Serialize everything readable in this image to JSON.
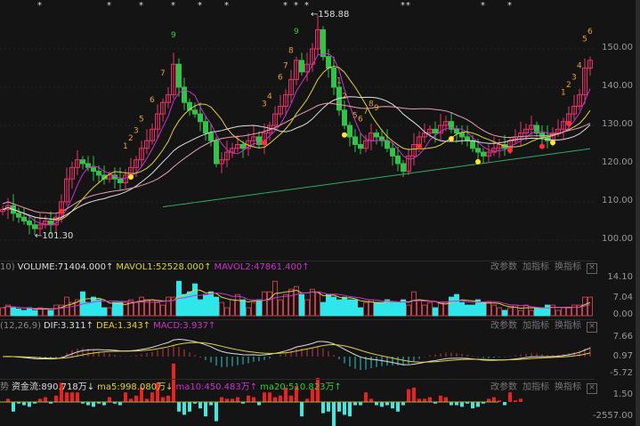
{
  "chart_data": {
    "type": "candlestick",
    "price_axis": {
      "ticks": [
        "150.00",
        "140.00",
        "130.00",
        "120.00",
        "110.00",
        "100.00"
      ],
      "range": [
        96,
        160
      ]
    },
    "closes": [
      108,
      109,
      107,
      106,
      105,
      104,
      103,
      104,
      105,
      104,
      106,
      110,
      116,
      119,
      121,
      120,
      119,
      118,
      117,
      116,
      117,
      116,
      115,
      117,
      119,
      121,
      124,
      126,
      129,
      133,
      136,
      138,
      146,
      140,
      136,
      134,
      133,
      131,
      128,
      126,
      120,
      121,
      123,
      124,
      125,
      124,
      126,
      127,
      125,
      128,
      130,
      133,
      135,
      138,
      142,
      147,
      144,
      146,
      150,
      155,
      148,
      145,
      140,
      134,
      130,
      127,
      125,
      124,
      126,
      128,
      127,
      126,
      124,
      122,
      120,
      118,
      122,
      125,
      127,
      128,
      129,
      128,
      130,
      131,
      129,
      128,
      127,
      126,
      124,
      123,
      122,
      123,
      124,
      125,
      124,
      126,
      127,
      128,
      129,
      130,
      128,
      127,
      126,
      128,
      129,
      131,
      133,
      135,
      138,
      145,
      147
    ],
    "volumes": [
      3,
      4,
      3,
      2.5,
      2,
      3,
      2,
      3,
      2.5,
      2,
      4,
      4,
      7,
      5,
      6,
      9,
      5,
      7,
      6,
      3,
      3,
      5,
      5,
      5,
      6,
      5,
      7,
      6,
      6,
      5,
      4,
      7,
      7,
      13,
      8,
      9,
      12,
      6,
      8,
      9,
      7,
      5,
      3,
      6,
      8,
      6,
      3,
      5,
      6,
      9,
      9,
      13,
      6,
      8,
      10,
      11,
      8,
      6,
      10,
      9,
      5,
      8,
      7,
      6,
      7,
      6,
      6,
      3,
      5,
      6,
      5,
      5,
      6,
      5,
      5,
      6,
      4,
      9,
      6,
      4,
      5,
      3,
      5,
      5,
      7,
      8,
      5,
      4,
      4,
      6,
      5,
      5,
      4,
      3,
      2,
      3,
      4,
      2,
      4,
      2,
      3,
      3,
      4,
      4,
      2,
      3,
      3,
      4,
      4,
      7,
      7
    ],
    "annotations": {
      "high": "←158.88",
      "low": "←101.30"
    },
    "count_labels": [
      {
        "i": 32,
        "t": "9",
        "c": "#3ad13a"
      },
      {
        "i": 26,
        "t": "5",
        "c": "#e6a23c"
      },
      {
        "i": 28,
        "t": "6",
        "c": "#e6a23c"
      },
      {
        "i": 30,
        "t": "7",
        "c": "#e6a23c"
      },
      {
        "i": 23,
        "t": "1",
        "c": "#e6a23c"
      },
      {
        "i": 24,
        "t": "2",
        "c": "#e6a23c"
      },
      {
        "i": 25,
        "t": "3",
        "c": "#e6a23c"
      },
      {
        "i": 49,
        "t": "3",
        "c": "#e6a23c"
      },
      {
        "i": 50,
        "t": "4",
        "c": "#e6a23c"
      },
      {
        "i": 52,
        "t": "6",
        "c": "#e6a23c"
      },
      {
        "i": 53,
        "t": "7",
        "c": "#e6a23c"
      },
      {
        "i": 54,
        "t": "8",
        "c": "#e6a23c"
      },
      {
        "i": 55,
        "t": "9",
        "c": "#3ad13a"
      },
      {
        "i": 63,
        "t": "1",
        "c": "#e6a23c"
      },
      {
        "i": 64,
        "t": "2",
        "c": "#e6a23c"
      },
      {
        "i": 66,
        "t": "5",
        "c": "#e6a23c"
      },
      {
        "i": 67,
        "t": "6",
        "c": "#e6a23c"
      },
      {
        "i": 68,
        "t": "7",
        "c": "#e6a23c"
      },
      {
        "i": 69,
        "t": "8",
        "c": "#e6a23c"
      },
      {
        "i": 70,
        "t": "9",
        "c": "#e6a23c"
      },
      {
        "i": 105,
        "t": "1",
        "c": "#e6a23c"
      },
      {
        "i": 106,
        "t": "2",
        "c": "#e6a23c"
      },
      {
        "i": 107,
        "t": "3",
        "c": "#e6a23c"
      },
      {
        "i": 108,
        "t": "4",
        "c": "#e6a23c"
      },
      {
        "i": 109,
        "t": "5",
        "c": "#e6a23c"
      },
      {
        "i": 110,
        "t": "6",
        "c": "#e6a23c"
      }
    ],
    "star_marks": [
      7,
      20,
      26,
      32,
      37,
      42,
      53,
      55,
      57,
      75,
      76,
      90,
      95
    ],
    "dots": [
      {
        "i": 11,
        "c": "#ff3030"
      },
      {
        "i": 24,
        "c": "#ffe633"
      },
      {
        "i": 49,
        "c": "#ff3030"
      },
      {
        "i": 64,
        "c": "#ffe633"
      },
      {
        "i": 78,
        "c": "#ff3030"
      },
      {
        "i": 84,
        "c": "#ffe633"
      },
      {
        "i": 89,
        "c": "#ffe633"
      },
      {
        "i": 95,
        "c": "#ff3030"
      },
      {
        "i": 101,
        "c": "#ff3030"
      },
      {
        "i": 103,
        "c": "#ffe633"
      },
      {
        "i": 106,
        "c": "#ff3030"
      }
    ]
  },
  "volume_panel": {
    "prefix": "10)",
    "volume": "VOLUME:71404.000↑",
    "mavol1": "MAVOL1:52528.000↑",
    "mavol2": "MAVOL2:47861.400↑",
    "ticks": [
      "14.10",
      "7.04",
      "0.00"
    ]
  },
  "macd_panel": {
    "prefix": "(12,26,9)",
    "dif": "DIF:3.311↑",
    "dea": "DEA:1.343↑",
    "macd": "MACD:3.937↑",
    "ticks": [
      "7.66",
      "0.97",
      "-5.72"
    ]
  },
  "fund_panel": {
    "prefix": "势",
    "flow": "资金流:890.718万↓",
    "ma5": "ma5:998.080万↓",
    "ma10": "ma10:450.483万↑",
    "ma20": "ma20:510.823万↑",
    "ticks": [
      "1.50",
      "-2557.00"
    ]
  },
  "tools": {
    "edit": "改参数",
    "add": "加指标",
    "swap": "换指标",
    "close": "×"
  },
  "colors": {
    "up": "#e8336a",
    "down": "#33c24a",
    "vol_up": "#c0404a",
    "vol_down": "#2fe6ea",
    "ma5": "#e0e0e0",
    "ma10": "#e0d040",
    "ma20": "#cc33cc",
    "ma60": "#33aa66"
  }
}
